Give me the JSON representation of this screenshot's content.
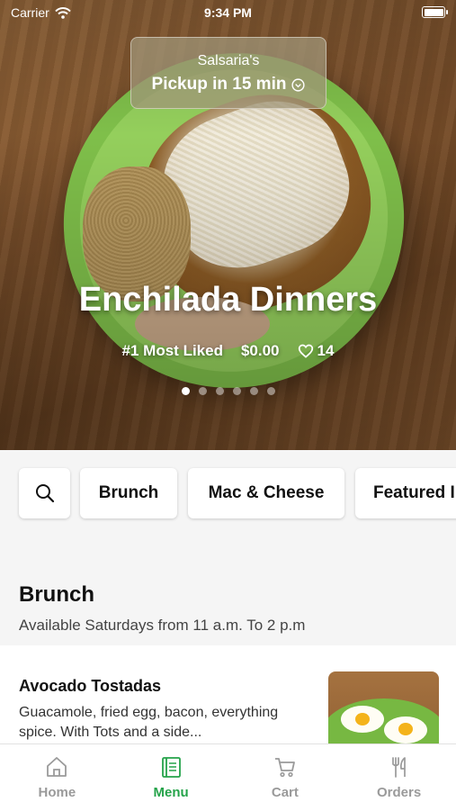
{
  "status_bar": {
    "carrier": "Carrier",
    "time": "9:34 PM"
  },
  "pickup": {
    "store": "Salsaria's",
    "when": "Pickup in 15 min"
  },
  "hero": {
    "title": "Enchilada Dinners",
    "rank": "#1 Most Liked",
    "price": "$0.00",
    "likes": "14",
    "pages": 6,
    "active_page": 1
  },
  "chips": [
    "Brunch",
    "Mac & Cheese",
    "Featured I"
  ],
  "section": {
    "title": "Brunch",
    "subtitle": "Available Saturdays from 11 a.m. To 2 p.m"
  },
  "item": {
    "name": "Avocado Tostadas",
    "description": "Guacamole, fried egg, bacon, everything spice. With Tots and a side..."
  },
  "tabs": [
    {
      "label": "Home",
      "icon": "home-icon",
      "active": false
    },
    {
      "label": "Menu",
      "icon": "menu-book-icon",
      "active": true
    },
    {
      "label": "Cart",
      "icon": "cart-icon",
      "active": false
    },
    {
      "label": "Orders",
      "icon": "utensils-icon",
      "active": false
    }
  ],
  "colors": {
    "accent": "#25a34a",
    "inactive_tab": "#9a9a9a"
  }
}
